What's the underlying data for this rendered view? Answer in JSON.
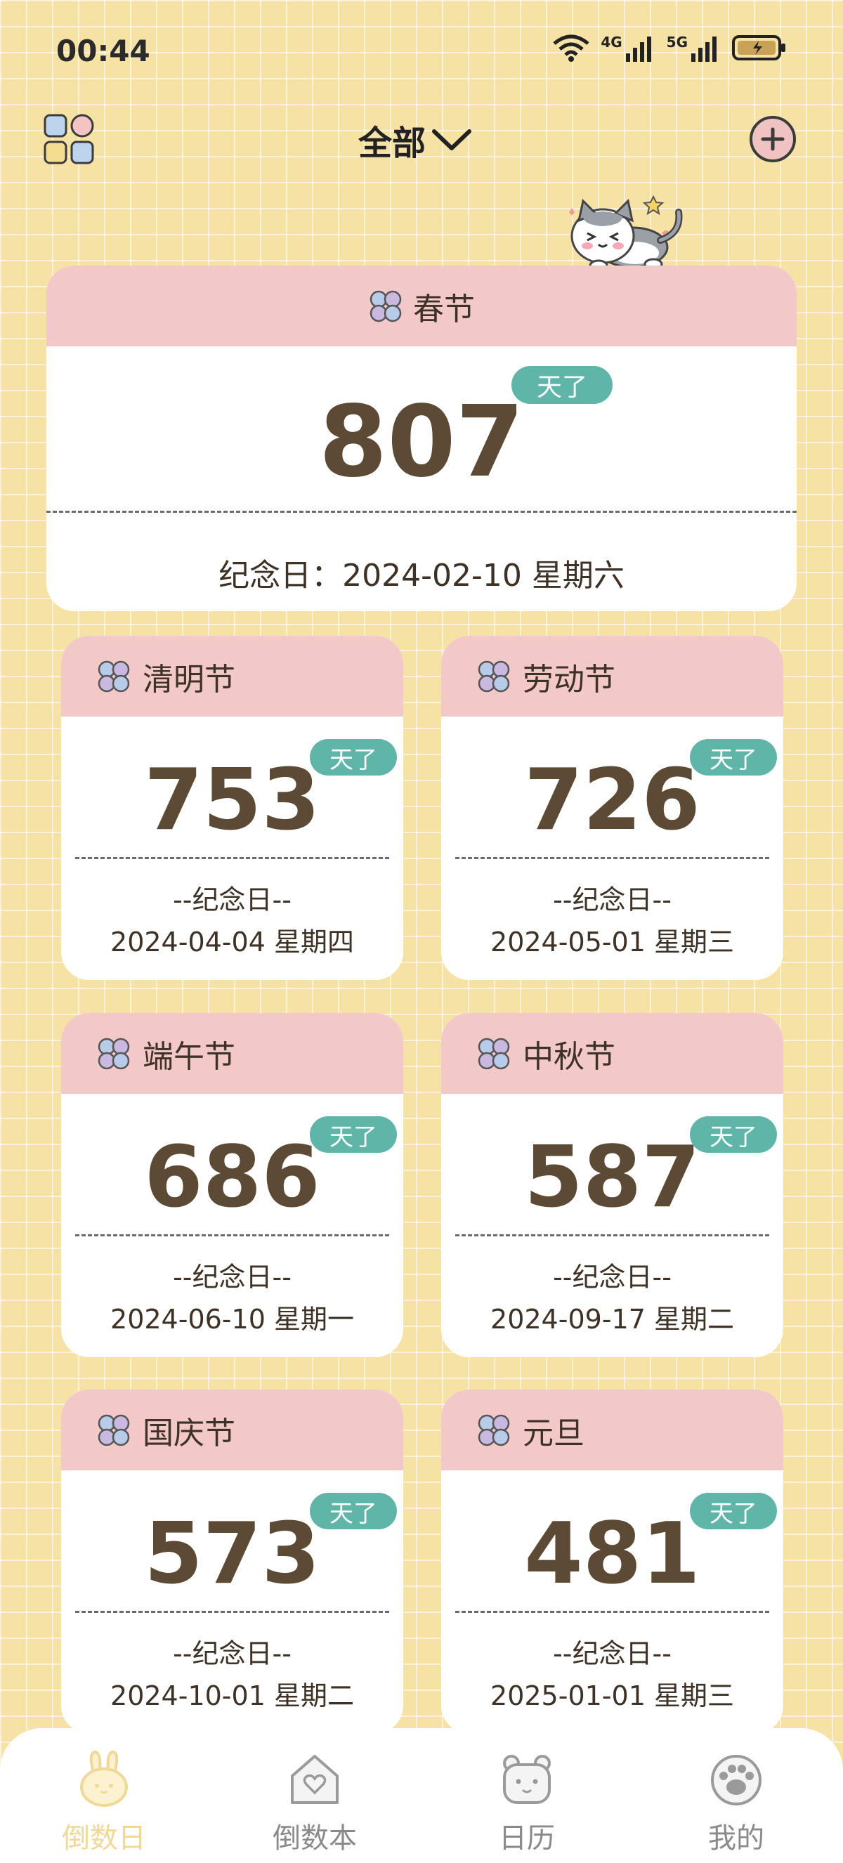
{
  "status": {
    "time": "00:44",
    "signal1": "4G",
    "signal2": "5G"
  },
  "header": {
    "title": "全部"
  },
  "colors": {
    "background": "#f7e2a6",
    "card_head": "#f2c8c8",
    "pill": "#5fb5a8",
    "number": "#5c4a35",
    "nav_active": "#f0d898"
  },
  "featured": {
    "name": "春节",
    "days": "807",
    "unit": "天了",
    "memo": "纪念日：2024-02-10 星期六"
  },
  "cards": [
    {
      "name": "清明节",
      "days": "753",
      "unit": "天了",
      "memo_label": "--纪念日--",
      "date": "2024-04-04 星期四"
    },
    {
      "name": "劳动节",
      "days": "726",
      "unit": "天了",
      "memo_label": "--纪念日--",
      "date": "2024-05-01 星期三"
    },
    {
      "name": "端午节",
      "days": "686",
      "unit": "天了",
      "memo_label": "--纪念日--",
      "date": "2024-06-10 星期一"
    },
    {
      "name": "中秋节",
      "days": "587",
      "unit": "天了",
      "memo_label": "--纪念日--",
      "date": "2024-09-17 星期二"
    },
    {
      "name": "国庆节",
      "days": "573",
      "unit": "天了",
      "memo_label": "--纪念日--",
      "date": "2024-10-01 星期二"
    },
    {
      "name": "元旦",
      "days": "481",
      "unit": "天了",
      "memo_label": "--纪念日--",
      "date": "2025-01-01 星期三"
    }
  ],
  "nav": {
    "items": [
      {
        "label": "倒数日",
        "icon": "bunny-icon",
        "active": true
      },
      {
        "label": "倒数本",
        "icon": "house-heart-icon",
        "active": false
      },
      {
        "label": "日历",
        "icon": "bear-calendar-icon",
        "active": false
      },
      {
        "label": "我的",
        "icon": "paw-icon",
        "active": false
      }
    ]
  }
}
